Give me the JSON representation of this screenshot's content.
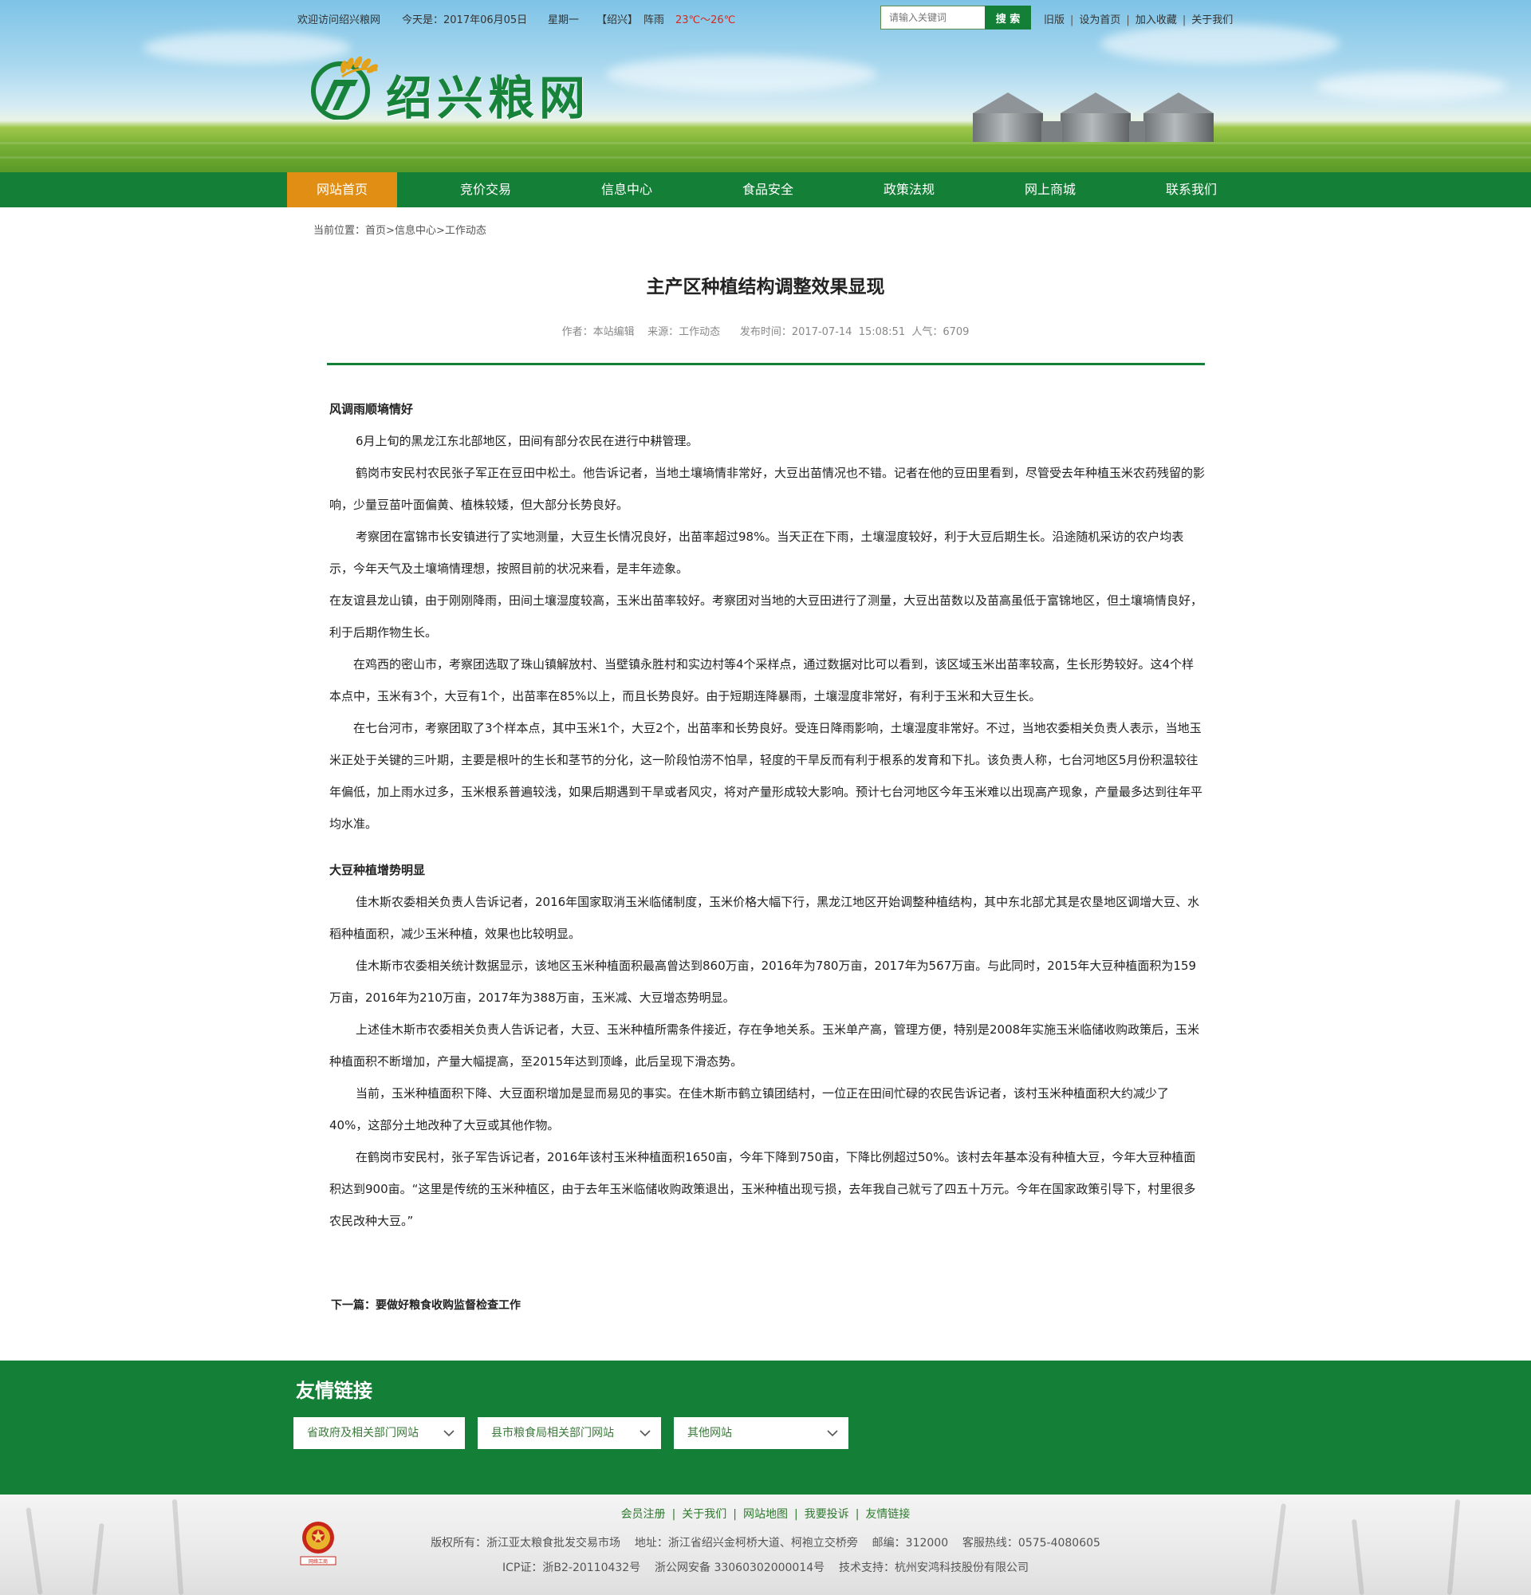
{
  "topbar": {
    "welcome": "欢迎访问绍兴粮网",
    "date": "今天是：2017年06月05日",
    "weekday": "星期一",
    "city": "【绍兴】",
    "weather": "阵雨",
    "temp": "23℃～26℃",
    "search_placeholder": "请输入关键词",
    "search_button": "搜 索",
    "links": [
      "旧版",
      "设为首页",
      "加入收藏",
      "关于我们"
    ]
  },
  "site": {
    "name": "绍兴粮网"
  },
  "nav": [
    "网站首页",
    "竞价交易",
    "信息中心",
    "食品安全",
    "政策法规",
    "网上商城",
    "联系我们"
  ],
  "breadcrumb": {
    "label": "当前位置：",
    "items": [
      "首页",
      "信息中心",
      "工作动态"
    ]
  },
  "article": {
    "title": "主产区种植结构调整效果显现",
    "meta": "作者：本站编辑    来源：工作动态      发布时间：2017-07-14  15:08:51  人气：6709",
    "paragraphs": [
      " 风调雨顺墒情好",
      "6月上旬的黑龙江东北部地区，田间有部分农民在进行中耕管理。",
      "鹤岗市安民村农民张子军正在豆田中松土。他告诉记者，当地土壤墒情非常好，大豆出苗情况也不错。记者在他的豆田里看到，尽管受去年种植玉米农药残留的影响，少量豆苗叶面偏黄、植株较矮，但大部分长势良好。",
      "考察团在富锦市长安镇进行了实地测量，大豆生长情况良好，出苗率超过98%。当天正在下雨，土壤湿度较好，利于大豆后期生长。沿途随机采访的农户均表示，今年天气及土壤墒情理想，按照目前的状况来看，是丰年迹象。",
      "在友谊县龙山镇，由于刚刚降雨，田间土壤湿度较高，玉米出苗率较好。考察团对当地的大豆田进行了测量，大豆出苗数以及苗高虽低于富锦地区，但土壤墒情良好，利于后期作物生长。",
      "在鸡西的密山市，考察团选取了珠山镇解放村、当壁镇永胜村和实边村等4个采样点，通过数据对比可以看到，该区域玉米出苗率较高，生长形势较好。这4个样本点中，玉米有3个，大豆有1个，出苗率在85%以上，而且长势良好。由于短期连降暴雨，土壤湿度非常好，有利于玉米和大豆生长。",
      "在七台河市，考察团取了3个样本点，其中玉米1个，大豆2个，出苗率和长势良好。受连日降雨影响，土壤湿度非常好。不过，当地农委相关负责人表示，当地玉米正处于关键的三叶期，主要是根叶的生长和茎节的分化，这一阶段怕涝不怕旱，轻度的干旱反而有利于根系的发育和下扎。该负责人称，七台河地区5月份积温较往年偏低，加上雨水过多，玉米根系普遍较浅，如果后期遇到干旱或者风灾，将对产量形成较大影响。预计七台河地区今年玉米难以出现高产现象，产量最多达到往年平均水准。",
      "大豆种植增势明显",
      "佳木斯农委相关负责人告诉记者，2016年国家取消玉米临储制度，玉米价格大幅下行，黑龙江地区开始调整种植结构，其中东北部尤其是农垦地区调增大豆、水稻种植面积，减少玉米种植，效果也比较明显。",
      "佳木斯市农委相关统计数据显示，该地区玉米种植面积最高曾达到860万亩，2016年为780万亩，2017年为567万亩。与此同时，2015年大豆种植面积为159万亩，2016年为210万亩，2017年为388万亩，玉米减、大豆增态势明显。",
      "上述佳木斯市农委相关负责人告诉记者，大豆、玉米种植所需条件接近，存在争地关系。玉米单产高，管理方便，特别是2008年实施玉米临储收购政策后，玉米种植面积不断增加，产量大幅提高，至2015年达到顶峰，此后呈现下滑态势。",
      "当前，玉米种植面积下降、大豆面积增加是显而易见的事实。在佳木斯市鹤立镇团结村，一位正在田间忙碌的农民告诉记者，该村玉米种植面积大约减少了40%，这部分土地改种了大豆或其他作物。",
      "在鹤岗市安民村，张子军告诉记者，2016年该村玉米种植面积1650亩，今年下降到750亩，下降比例超过50%。该村去年基本没有种植大豆，今年大豆种植面积达到900亩。“这里是传统的玉米种植区，由于去年玉米临储收购政策退出，玉米种植出现亏损，去年我自己就亏了四五十万元。今年在国家政策引导下，村里很多农民改种大豆。”"
    ],
    "next_label": "下一篇：",
    "next_title": "要做好粮食收购监督检查工作"
  },
  "friend_links": {
    "title": "友情链接",
    "dropdowns": [
      "省政府及相关部门网站",
      "县市粮食局相关部门网站",
      "其他网站"
    ]
  },
  "footer": {
    "links": [
      "会员注册",
      "关于我们",
      "网站地图",
      "我要投诉",
      "友情链接"
    ],
    "line1": "版权所有：浙江亚太粮食批发交易市场    地址：浙江省绍兴金柯桥大道、柯袍立交桥旁    邮编：312000    客服热线：0575-4080605",
    "line2": "ICP证：浙B2-20110432号    浙公网安备 33060302000014号    技术支持：杭州安鸿科技股份有限公司",
    "emblem_caption": "网络工商"
  },
  "colors": {
    "brand_green": "#148037",
    "nav_active": "#e08e14",
    "temp_red": "#d8281c"
  }
}
